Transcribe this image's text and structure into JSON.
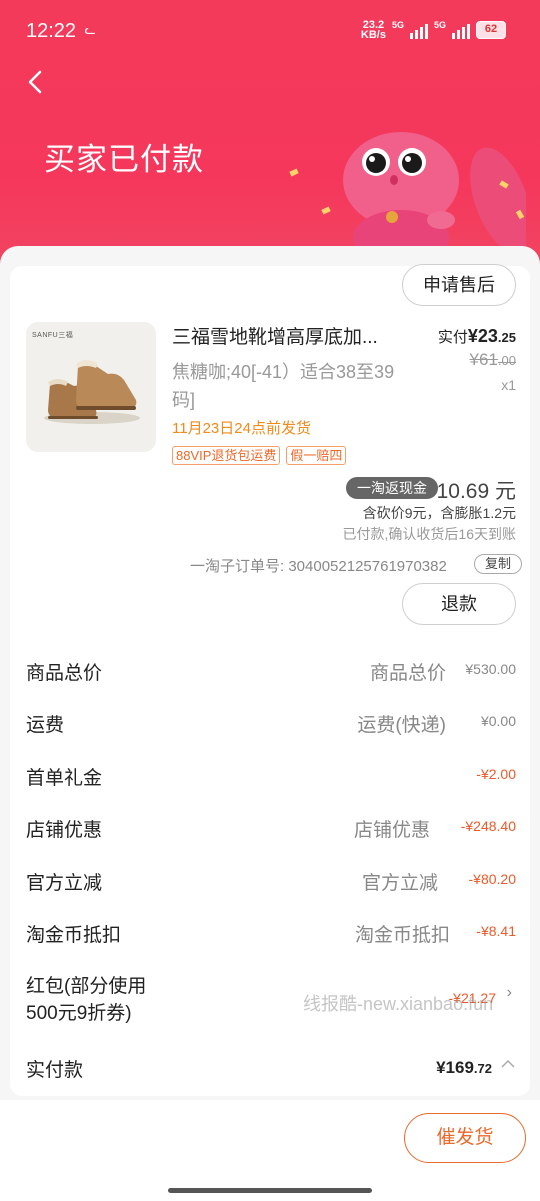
{
  "status_bar": {
    "time": "12:22",
    "net_speed_value": "23.2",
    "net_speed_unit": "KB/s",
    "sig1": "5G",
    "sig2": "5G",
    "battery": "62"
  },
  "header": {
    "title": "买家已付款"
  },
  "order": {
    "after_sale_btn": "申请售后",
    "product": {
      "brand_logo_text": "SANFU三福",
      "name": "三福雪地靴增高厚底加绒加厚",
      "name_ellipsis": "三福雪地靴增高厚底加...",
      "sku": "焦糖咖;40[-41）适合38至39码]",
      "ship_time": "11月23日24点前发货",
      "tags": [
        "88VIP退货包运费",
        "假一赔四"
      ],
      "price_label": "实付",
      "price_currency": "¥",
      "price_int": "23",
      "price_dec": ".25",
      "orig_price_int": "¥61",
      "orig_price_dec": ".00",
      "qty": "x1"
    },
    "cashback": {
      "badge": "一淘返现金",
      "amount": "10.69 元",
      "note1": "含砍价9元，含膨胀1.2元",
      "note2": "已付款,确认收货后16天到账"
    },
    "order_no": "一淘子订单号: 3040052125761970382",
    "copy_btn": "复制",
    "refund_btn": "退款"
  },
  "fees": {
    "goods_total": {
      "label": "商品总价",
      "sub": "商品总价",
      "value": "¥530.00"
    },
    "shipping": {
      "label": "运费",
      "sub": "运费(快递)",
      "value": "¥0.00"
    },
    "first_gift": {
      "label": "首单礼金",
      "value": "-¥2.00"
    },
    "shop_discount": {
      "label": "店铺优惠",
      "sub": "店铺优惠",
      "value": "-¥248.40"
    },
    "official_discount": {
      "label": "官方立减",
      "sub": "官方立减",
      "value": "-¥80.20"
    },
    "gold_coin": {
      "label": "淘金币抵扣",
      "sub": "淘金币抵扣",
      "value": "-¥8.41"
    },
    "red_packet": {
      "label_line1": "红包(部分使用",
      "label_line2": "500元9折券)",
      "value": "-¥21.27"
    },
    "total": {
      "label": "实付款",
      "value_int": "¥169",
      "value_dec": ".72"
    }
  },
  "watermark": "线报酷-new.xianbao.fun",
  "bottom": {
    "urge_btn": "催发货"
  },
  "colors": {
    "header_red": "#f33a5a",
    "accent_orange": "#ea6a2b",
    "discount_orange": "#ea5a2a",
    "ship_time_orange": "#ef8a1b"
  },
  "icons": {
    "back": "chevron-left-icon",
    "total_toggle": "chevron-up-icon",
    "red_packet": "chevron-right-icon"
  }
}
